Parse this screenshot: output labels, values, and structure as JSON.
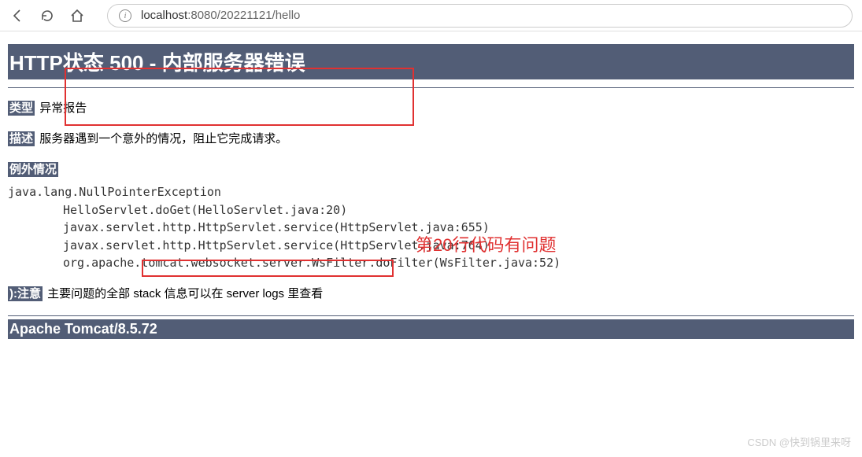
{
  "toolbar": {
    "url_host": "localhost",
    "url_rest": ":8080/20221121/hello"
  },
  "page": {
    "heading": "HTTP状态 500 - 内部服务器错误",
    "type_label": "类型",
    "type_value": "异常报告",
    "desc_label": "描述",
    "desc_value": "服务器遇到一个意外的情况，阻止它完成请求。",
    "exception_label": "例外情况",
    "stack": [
      "java.lang.NullPointerException",
      "HelloServlet.doGet(HelloServlet.java:20)",
      "javax.servlet.http.HttpServlet.service(HttpServlet.java:655)",
      "javax.servlet.http.HttpServlet.service(HttpServlet.java:764)",
      "org.apache.tomcat.websocket.server.WsFilter.doFilter(WsFilter.java:52)"
    ],
    "note_label": "):注意",
    "note_value": "主要问题的全部 stack 信息可以在 server logs 里查看",
    "footer": "Apache Tomcat/8.5.72"
  },
  "annotation": "第20行代码有问题",
  "watermark": "CSDN @快到锅里来呀"
}
